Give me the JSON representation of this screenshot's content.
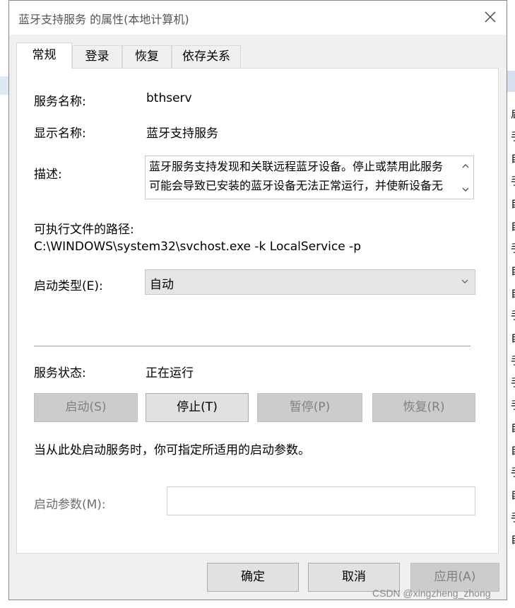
{
  "dialog": {
    "title": "蓝牙支持服务 的属性(本地计算机)"
  },
  "tabs": [
    {
      "label": "常规",
      "active": true
    },
    {
      "label": "登录",
      "active": false
    },
    {
      "label": "恢复",
      "active": false
    },
    {
      "label": "依存关系",
      "active": false
    }
  ],
  "general": {
    "service_name_label": "服务名称:",
    "service_name": "bthserv",
    "display_name_label": "显示名称:",
    "display_name": "蓝牙支持服务",
    "description_label": "描述:",
    "description": "蓝牙服务支持发现和关联远程蓝牙设备。停止或禁用此服务可能会导致已安装的蓝牙设备无法正常运行，并使新设备无法被发现或关联。",
    "exe_path_label": "可执行文件的路径:",
    "exe_path": "C:\\WINDOWS\\system32\\svchost.exe -k LocalService -p",
    "startup_type_label": "启动类型(E):",
    "startup_type": "自动",
    "service_status_label": "服务状态:",
    "service_status": "正在运行",
    "buttons": {
      "start": "启动(S)",
      "stop": "停止(T)",
      "pause": "暂停(P)",
      "resume": "恢复(R)"
    },
    "hint": "当从此处启动服务时，你可指定所适用的启动参数。",
    "start_params_label": "启动参数(M):",
    "start_params_value": ""
  },
  "footer": {
    "ok": "确定",
    "cancel": "取消",
    "apply": "应用(A)"
  },
  "watermark": "CSDN @xingzheng_zhong",
  "background": {
    "right_chars": [
      "启",
      "手",
      "自",
      "手",
      "自",
      "自",
      "手",
      "自",
      "自",
      "手",
      "自",
      "手",
      "手",
      "手",
      "自",
      "自",
      "手",
      "自",
      "手",
      "自"
    ]
  }
}
